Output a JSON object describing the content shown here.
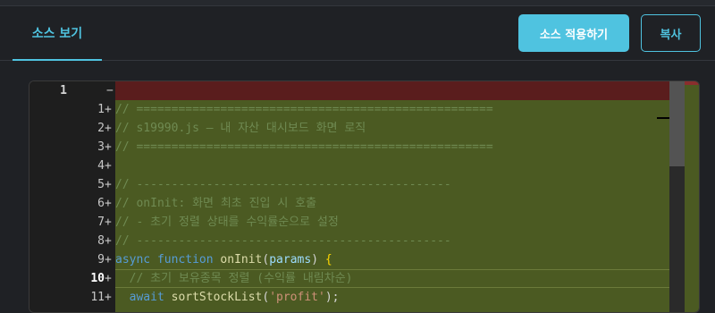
{
  "header": {
    "tab_label": "소스 보기",
    "apply_label": "소스 적용하기",
    "copy_label": "복사"
  },
  "editor": {
    "old_line_numbers": [
      "1"
    ],
    "removed_marker": "−",
    "new_line_numbers": [
      "1",
      "2",
      "3",
      "4",
      "5",
      "6",
      "7",
      "8",
      "9",
      "10",
      "11"
    ],
    "active_line": "10",
    "lines": [
      {
        "parts": [
          {
            "c": "cmt",
            "t": "// ==================================================="
          }
        ]
      },
      {
        "parts": [
          {
            "c": "cmt",
            "t": "// s19990.js – 내 자산 대시보드 화면 로직"
          }
        ]
      },
      {
        "parts": [
          {
            "c": "cmt",
            "t": "// ==================================================="
          }
        ]
      },
      {
        "parts": [
          {
            "c": "txt",
            "t": ""
          }
        ]
      },
      {
        "parts": [
          {
            "c": "cmt",
            "t": "// ---------------------------------------------"
          }
        ]
      },
      {
        "parts": [
          {
            "c": "cmt",
            "t": "// onInit: 화면 최초 진입 시 호출"
          }
        ]
      },
      {
        "parts": [
          {
            "c": "cmt",
            "t": "// - 초기 정렬 상태를 수익률순으로 설정"
          }
        ]
      },
      {
        "parts": [
          {
            "c": "cmt",
            "t": "// ---------------------------------------------"
          }
        ]
      },
      {
        "parts": [
          {
            "c": "kw",
            "t": "async "
          },
          {
            "c": "kw",
            "t": "function "
          },
          {
            "c": "fn",
            "t": "onInit"
          },
          {
            "c": "txt",
            "t": "("
          },
          {
            "c": "pm",
            "t": "params"
          },
          {
            "c": "txt",
            "t": ") "
          },
          {
            "c": "br",
            "t": "{"
          }
        ]
      },
      {
        "parts": [
          {
            "c": "cmt",
            "t": "  // 초기 보유종목 정렬 (수익률 내림차순)"
          }
        ]
      },
      {
        "parts": [
          {
            "c": "kw",
            "t": "  await "
          },
          {
            "c": "fn",
            "t": "sortStockList"
          },
          {
            "c": "txt",
            "t": "("
          },
          {
            "c": "str",
            "t": "'profit'"
          },
          {
            "c": "txt",
            "t": ");"
          }
        ]
      }
    ]
  },
  "colors": {
    "accent": "#4fc3e0",
    "removed_bg": "#5a1d1d",
    "added_bg": "#4b5a22"
  }
}
